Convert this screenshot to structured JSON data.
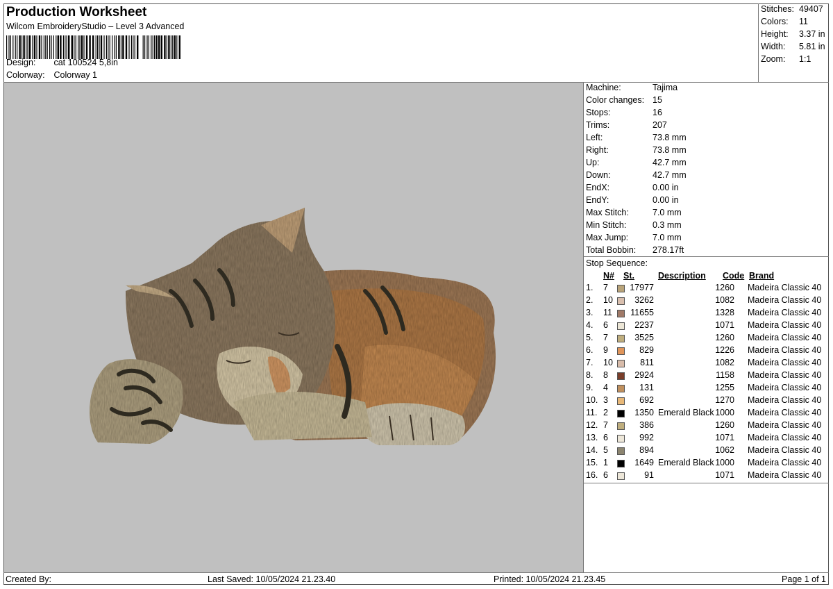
{
  "header": {
    "title": "Production Worksheet",
    "subtitle": "Wilcom EmbroideryStudio – Level 3 Advanced",
    "design_label": "Design:",
    "design_value": "cat 100524 5,8in",
    "colorway_label": "Colorway:",
    "colorway_value": "Colorway 1"
  },
  "summary": [
    {
      "label": "Stitches:",
      "value": "49407"
    },
    {
      "label": "Colors:",
      "value": "11"
    },
    {
      "label": "Height:",
      "value": "3.37 in"
    },
    {
      "label": "Width:",
      "value": "5.81 in"
    },
    {
      "label": "Zoom:",
      "value": "1:1"
    }
  ],
  "machine_info": [
    {
      "label": "Machine:",
      "value": "Tajima"
    },
    {
      "label": "Color changes:",
      "value": "15"
    },
    {
      "label": "Stops:",
      "value": "16"
    },
    {
      "label": "Trims:",
      "value": "207"
    },
    {
      "label": "Left:",
      "value": "73.8 mm"
    },
    {
      "label": "Right:",
      "value": "73.8 mm"
    },
    {
      "label": "Up:",
      "value": "42.7 mm"
    },
    {
      "label": "Down:",
      "value": "42.7 mm"
    },
    {
      "label": "EndX:",
      "value": "0.00 in"
    },
    {
      "label": "EndY:",
      "value": "0.00 in"
    },
    {
      "label": "Max Stitch:",
      "value": "7.0 mm"
    },
    {
      "label": "Min Stitch:",
      "value": "0.3 mm"
    },
    {
      "label": "Max Jump:",
      "value": "7.0 mm"
    },
    {
      "label": "Total Bobbin:",
      "value": "278.17ft"
    }
  ],
  "stop_sequence": {
    "title": "Stop Sequence:",
    "headers": {
      "n": "N#",
      "st": "St.",
      "desc": "Description",
      "code": "Code",
      "brand": "Brand"
    },
    "rows": [
      {
        "idx": "1.",
        "n": "7",
        "color": "#b9a47a",
        "st": "17977",
        "desc": "",
        "code": "1260",
        "brand": "Madeira Classic 40"
      },
      {
        "idx": "2.",
        "n": "10",
        "color": "#d9bfae",
        "st": "3262",
        "desc": "",
        "code": "1082",
        "brand": "Madeira Classic 40"
      },
      {
        "idx": "3.",
        "n": "11",
        "color": "#a07a68",
        "st": "11655",
        "desc": "",
        "code": "1328",
        "brand": "Madeira Classic 40"
      },
      {
        "idx": "4.",
        "n": "6",
        "color": "#ece6d6",
        "st": "2237",
        "desc": "",
        "code": "1071",
        "brand": "Madeira Classic 40"
      },
      {
        "idx": "5.",
        "n": "7",
        "color": "#bfae7e",
        "st": "3525",
        "desc": "",
        "code": "1260",
        "brand": "Madeira Classic 40"
      },
      {
        "idx": "6.",
        "n": "9",
        "color": "#e0955a",
        "st": "829",
        "desc": "",
        "code": "1226",
        "brand": "Madeira Classic 40"
      },
      {
        "idx": "7.",
        "n": "10",
        "color": "#d8bcaa",
        "st": "811",
        "desc": "",
        "code": "1082",
        "brand": "Madeira Classic 40"
      },
      {
        "idx": "8.",
        "n": "8",
        "color": "#7a3e2a",
        "st": "2924",
        "desc": "",
        "code": "1158",
        "brand": "Madeira Classic 40"
      },
      {
        "idx": "9.",
        "n": "4",
        "color": "#c0905e",
        "st": "131",
        "desc": "",
        "code": "1255",
        "brand": "Madeira Classic 40"
      },
      {
        "idx": "10.",
        "n": "3",
        "color": "#e8b878",
        "st": "692",
        "desc": "",
        "code": "1270",
        "brand": "Madeira Classic 40"
      },
      {
        "idx": "11.",
        "n": "2",
        "color": "#000000",
        "st": "1350",
        "desc": "Emerald Black",
        "code": "1000",
        "brand": "Madeira Classic 40"
      },
      {
        "idx": "12.",
        "n": "7",
        "color": "#bfae7e",
        "st": "386",
        "desc": "",
        "code": "1260",
        "brand": "Madeira Classic 40"
      },
      {
        "idx": "13.",
        "n": "6",
        "color": "#ede7d9",
        "st": "992",
        "desc": "",
        "code": "1071",
        "brand": "Madeira Classic 40"
      },
      {
        "idx": "14.",
        "n": "5",
        "color": "#8c8570",
        "st": "894",
        "desc": "",
        "code": "1062",
        "brand": "Madeira Classic 40"
      },
      {
        "idx": "15.",
        "n": "1",
        "color": "#000000",
        "st": "1649",
        "desc": "Emerald Black",
        "code": "1000",
        "brand": "Madeira Classic 40"
      },
      {
        "idx": "16.",
        "n": "6",
        "color": "#ede7d9",
        "st": "91",
        "desc": "",
        "code": "1071",
        "brand": "Madeira Classic 40"
      }
    ]
  },
  "footer": {
    "created": "Created By:",
    "saved": "Last Saved: 10/05/2024 21.23.40",
    "printed": "Printed: 10/05/2024 21.23.45",
    "page": "Page 1 of 1"
  },
  "preview": {
    "background": "#c0c0c0"
  }
}
